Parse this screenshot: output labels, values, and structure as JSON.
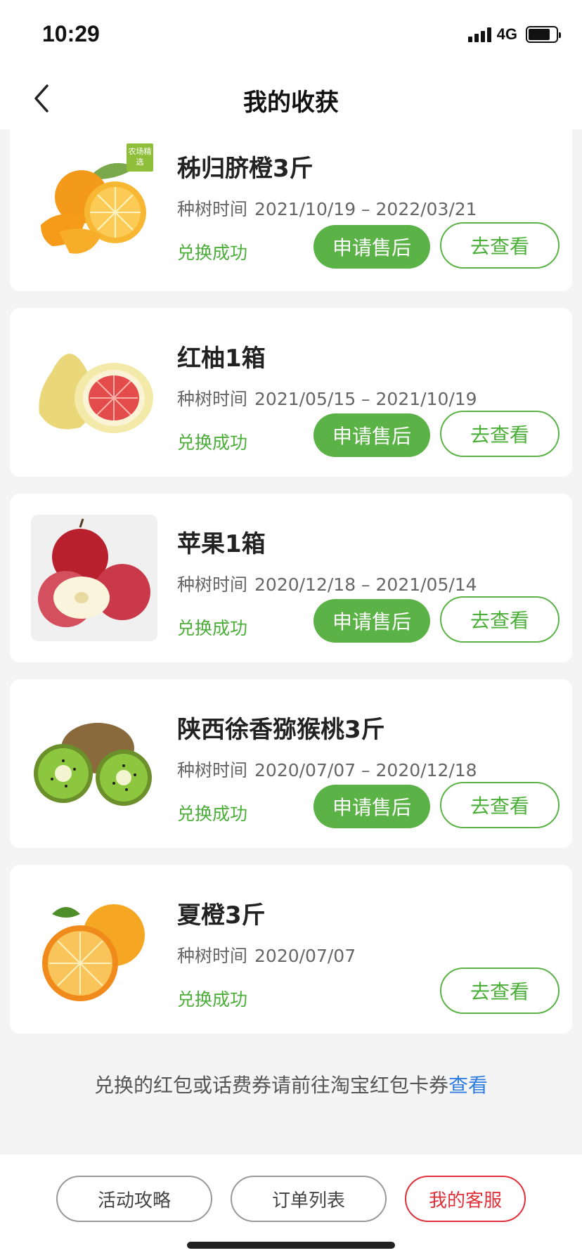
{
  "status_bar": {
    "time": "10:29",
    "network": "4G"
  },
  "nav": {
    "title": "我的收获"
  },
  "colors": {
    "accent_green": "#5bb247",
    "link_blue": "#2f7de0",
    "service_red": "#e0303a"
  },
  "harvests": [
    {
      "title": "秭归脐橙3斤",
      "period_label": "种树时间",
      "period": "2021/10/19 – 2022/03/21",
      "status": "兑换成功",
      "aftersale_label": "申请售后",
      "view_label": "去查看",
      "image": "navel-orange",
      "badge": "农场精选"
    },
    {
      "title": "红柚1箱",
      "period_label": "种树时间",
      "period": "2021/05/15 – 2021/10/19",
      "status": "兑换成功",
      "aftersale_label": "申请售后",
      "view_label": "去查看",
      "image": "red-pomelo"
    },
    {
      "title": "苹果1箱",
      "period_label": "种树时间",
      "period": "2020/12/18 – 2021/05/14",
      "status": "兑换成功",
      "aftersale_label": "申请售后",
      "view_label": "去查看",
      "image": "apple"
    },
    {
      "title": "陕西徐香猕猴桃3斤",
      "period_label": "种树时间",
      "period": "2020/07/07 – 2020/12/18",
      "status": "兑换成功",
      "aftersale_label": "申请售后",
      "view_label": "去查看",
      "image": "kiwi"
    },
    {
      "title": "夏橙3斤",
      "period_label": "种树时间",
      "period": "2020/07/07",
      "status": "兑换成功",
      "view_label": "去查看",
      "image": "summer-orange"
    }
  ],
  "notice": {
    "text": "兑换的红包或话费券请前往淘宝红包卡券",
    "link": "查看"
  },
  "footer": {
    "guide": "活动攻略",
    "orders": "订单列表",
    "service": "我的客服"
  }
}
